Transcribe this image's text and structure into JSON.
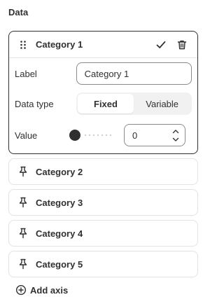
{
  "section": {
    "title": "Data"
  },
  "expanded_category": {
    "title": "Category 1",
    "label_field": {
      "label": "Label",
      "value": "Category 1"
    },
    "data_type": {
      "label": "Data type",
      "options": [
        "Fixed",
        "Variable"
      ],
      "selected": "Fixed"
    },
    "value_field": {
      "label": "Value",
      "value": "0",
      "slider_level": 0
    }
  },
  "categories": [
    {
      "label": "Category 2"
    },
    {
      "label": "Category 3"
    },
    {
      "label": "Category 4"
    },
    {
      "label": "Category 5"
    }
  ],
  "add_axis": {
    "label": "Add axis"
  },
  "icons": {
    "drag": "drag-handle-icon",
    "confirm": "checkmark-icon",
    "delete": "trash-icon",
    "pin": "pin-icon",
    "add": "plus-circle-icon"
  },
  "colors": {
    "text": "#303030",
    "border_active": "#303030",
    "border": "#e3e3e3"
  }
}
